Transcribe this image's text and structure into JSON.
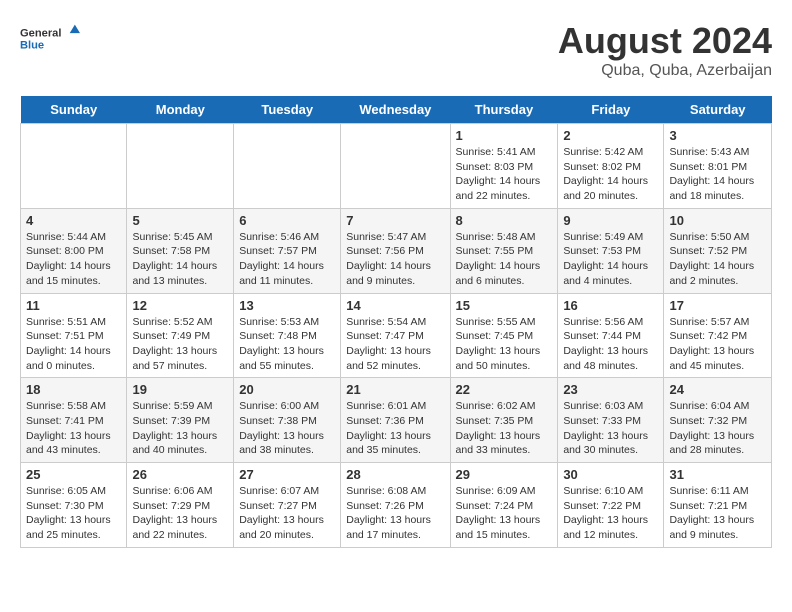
{
  "logo": {
    "text_general": "General",
    "text_blue": "Blue"
  },
  "title": "August 2024",
  "subtitle": "Quba, Quba, Azerbaijan",
  "weekdays": [
    "Sunday",
    "Monday",
    "Tuesday",
    "Wednesday",
    "Thursday",
    "Friday",
    "Saturday"
  ],
  "weeks": [
    [
      {
        "day": "",
        "info": ""
      },
      {
        "day": "",
        "info": ""
      },
      {
        "day": "",
        "info": ""
      },
      {
        "day": "",
        "info": ""
      },
      {
        "day": "1",
        "info": "Sunrise: 5:41 AM\nSunset: 8:03 PM\nDaylight: 14 hours\nand 22 minutes."
      },
      {
        "day": "2",
        "info": "Sunrise: 5:42 AM\nSunset: 8:02 PM\nDaylight: 14 hours\nand 20 minutes."
      },
      {
        "day": "3",
        "info": "Sunrise: 5:43 AM\nSunset: 8:01 PM\nDaylight: 14 hours\nand 18 minutes."
      }
    ],
    [
      {
        "day": "4",
        "info": "Sunrise: 5:44 AM\nSunset: 8:00 PM\nDaylight: 14 hours\nand 15 minutes."
      },
      {
        "day": "5",
        "info": "Sunrise: 5:45 AM\nSunset: 7:58 PM\nDaylight: 14 hours\nand 13 minutes."
      },
      {
        "day": "6",
        "info": "Sunrise: 5:46 AM\nSunset: 7:57 PM\nDaylight: 14 hours\nand 11 minutes."
      },
      {
        "day": "7",
        "info": "Sunrise: 5:47 AM\nSunset: 7:56 PM\nDaylight: 14 hours\nand 9 minutes."
      },
      {
        "day": "8",
        "info": "Sunrise: 5:48 AM\nSunset: 7:55 PM\nDaylight: 14 hours\nand 6 minutes."
      },
      {
        "day": "9",
        "info": "Sunrise: 5:49 AM\nSunset: 7:53 PM\nDaylight: 14 hours\nand 4 minutes."
      },
      {
        "day": "10",
        "info": "Sunrise: 5:50 AM\nSunset: 7:52 PM\nDaylight: 14 hours\nand 2 minutes."
      }
    ],
    [
      {
        "day": "11",
        "info": "Sunrise: 5:51 AM\nSunset: 7:51 PM\nDaylight: 14 hours\nand 0 minutes."
      },
      {
        "day": "12",
        "info": "Sunrise: 5:52 AM\nSunset: 7:49 PM\nDaylight: 13 hours\nand 57 minutes."
      },
      {
        "day": "13",
        "info": "Sunrise: 5:53 AM\nSunset: 7:48 PM\nDaylight: 13 hours\nand 55 minutes."
      },
      {
        "day": "14",
        "info": "Sunrise: 5:54 AM\nSunset: 7:47 PM\nDaylight: 13 hours\nand 52 minutes."
      },
      {
        "day": "15",
        "info": "Sunrise: 5:55 AM\nSunset: 7:45 PM\nDaylight: 13 hours\nand 50 minutes."
      },
      {
        "day": "16",
        "info": "Sunrise: 5:56 AM\nSunset: 7:44 PM\nDaylight: 13 hours\nand 48 minutes."
      },
      {
        "day": "17",
        "info": "Sunrise: 5:57 AM\nSunset: 7:42 PM\nDaylight: 13 hours\nand 45 minutes."
      }
    ],
    [
      {
        "day": "18",
        "info": "Sunrise: 5:58 AM\nSunset: 7:41 PM\nDaylight: 13 hours\nand 43 minutes."
      },
      {
        "day": "19",
        "info": "Sunrise: 5:59 AM\nSunset: 7:39 PM\nDaylight: 13 hours\nand 40 minutes."
      },
      {
        "day": "20",
        "info": "Sunrise: 6:00 AM\nSunset: 7:38 PM\nDaylight: 13 hours\nand 38 minutes."
      },
      {
        "day": "21",
        "info": "Sunrise: 6:01 AM\nSunset: 7:36 PM\nDaylight: 13 hours\nand 35 minutes."
      },
      {
        "day": "22",
        "info": "Sunrise: 6:02 AM\nSunset: 7:35 PM\nDaylight: 13 hours\nand 33 minutes."
      },
      {
        "day": "23",
        "info": "Sunrise: 6:03 AM\nSunset: 7:33 PM\nDaylight: 13 hours\nand 30 minutes."
      },
      {
        "day": "24",
        "info": "Sunrise: 6:04 AM\nSunset: 7:32 PM\nDaylight: 13 hours\nand 28 minutes."
      }
    ],
    [
      {
        "day": "25",
        "info": "Sunrise: 6:05 AM\nSunset: 7:30 PM\nDaylight: 13 hours\nand 25 minutes."
      },
      {
        "day": "26",
        "info": "Sunrise: 6:06 AM\nSunset: 7:29 PM\nDaylight: 13 hours\nand 22 minutes."
      },
      {
        "day": "27",
        "info": "Sunrise: 6:07 AM\nSunset: 7:27 PM\nDaylight: 13 hours\nand 20 minutes."
      },
      {
        "day": "28",
        "info": "Sunrise: 6:08 AM\nSunset: 7:26 PM\nDaylight: 13 hours\nand 17 minutes."
      },
      {
        "day": "29",
        "info": "Sunrise: 6:09 AM\nSunset: 7:24 PM\nDaylight: 13 hours\nand 15 minutes."
      },
      {
        "day": "30",
        "info": "Sunrise: 6:10 AM\nSunset: 7:22 PM\nDaylight: 13 hours\nand 12 minutes."
      },
      {
        "day": "31",
        "info": "Sunrise: 6:11 AM\nSunset: 7:21 PM\nDaylight: 13 hours\nand 9 minutes."
      }
    ]
  ]
}
